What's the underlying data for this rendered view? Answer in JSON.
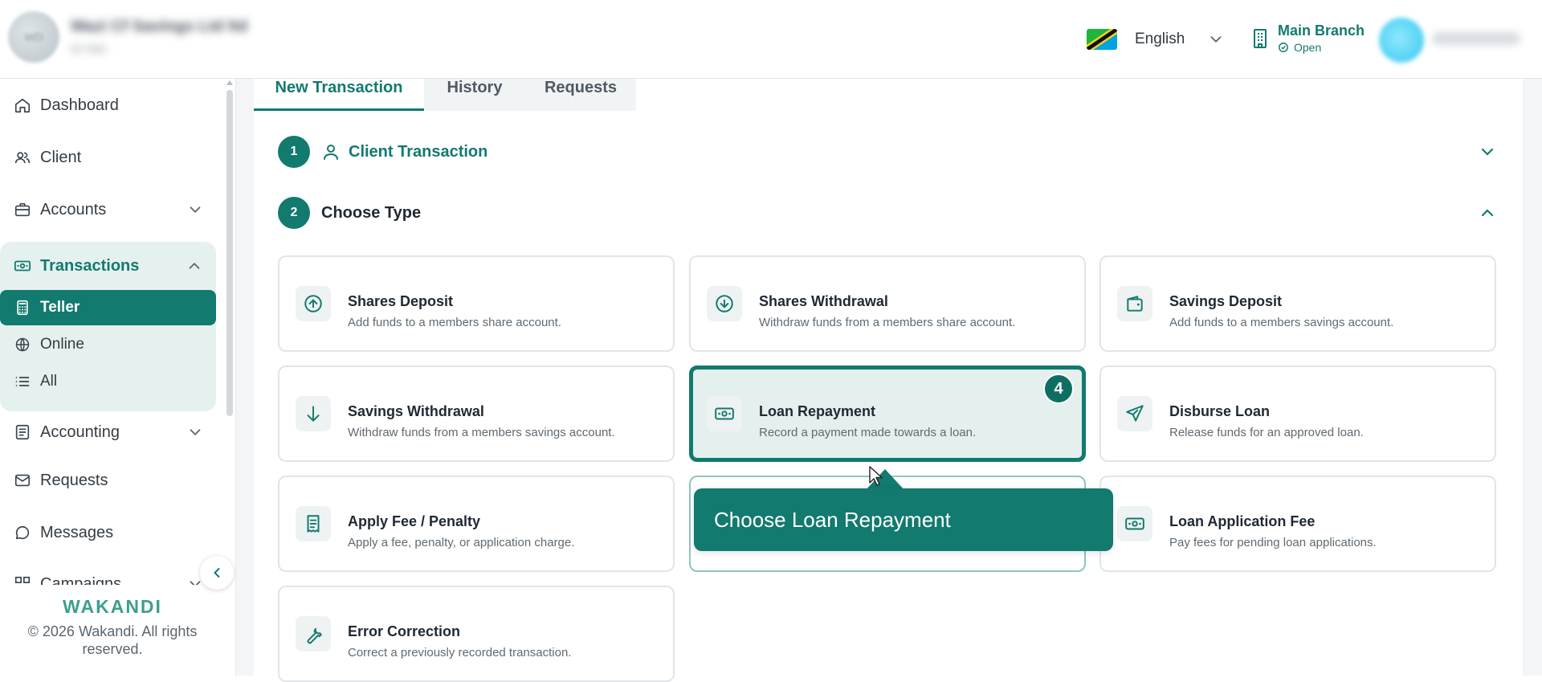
{
  "header": {
    "org_avatar_text": "WD",
    "org_name": "Wazi Cf Savings Ltd ltd",
    "org_sub": "ID 000",
    "language": "English",
    "branch_name": "Main Branch",
    "branch_status": "Open",
    "user_name": "Wakandi Admin"
  },
  "sidebar": {
    "items": [
      {
        "label": "Dashboard",
        "icon": "home-icon"
      },
      {
        "label": "Client",
        "icon": "users-icon"
      },
      {
        "label": "Accounts",
        "icon": "briefcase-icon"
      },
      {
        "label": "Transactions",
        "icon": "banknote-icon"
      },
      {
        "label": "Accounting",
        "icon": "ledger-icon"
      },
      {
        "label": "Requests",
        "icon": "mail-icon"
      },
      {
        "label": "Messages",
        "icon": "chat-icon"
      },
      {
        "label": "Campaigns",
        "icon": "grid-icon"
      }
    ],
    "sub_items": [
      {
        "label": "Teller",
        "icon": "calculator-icon"
      },
      {
        "label": "Online",
        "icon": "globe-icon"
      },
      {
        "label": "All",
        "icon": "list-icon"
      }
    ],
    "brand": "WAKANDI",
    "copyright": "© 2026 Wakandi. All rights reserved."
  },
  "tabs": [
    "New Transaction",
    "History",
    "Requests"
  ],
  "steps": [
    {
      "number": "1",
      "title": "Client Transaction"
    },
    {
      "number": "2",
      "title": "Choose Type"
    }
  ],
  "cards": [
    {
      "title": "Shares Deposit",
      "description": "Add funds to a members share account.",
      "icon": "arrow-up-circle-icon"
    },
    {
      "title": "Shares Withdrawal",
      "description": "Withdraw funds from a members share account.",
      "icon": "arrow-down-circle-icon"
    },
    {
      "title": "Savings Deposit",
      "description": "Add funds to a members savings account.",
      "icon": "wallet-icon"
    },
    {
      "title": "Savings Withdrawal",
      "description": "Withdraw funds from a members savings account.",
      "icon": "arrow-down-icon"
    },
    {
      "title": "Loan Repayment",
      "description": "Record a payment made towards a loan.",
      "icon": "banknote-icon"
    },
    {
      "title": "Disburse Loan",
      "description": "Release funds for an approved loan.",
      "icon": "send-icon"
    },
    {
      "title": "Apply Fee / Penalty",
      "description": "Apply a fee, penalty, or application charge.",
      "icon": "receipt-icon"
    },
    {
      "title": "",
      "description": "",
      "icon": ""
    },
    {
      "title": "Loan Application Fee",
      "description": "Pay fees for pending loan applications.",
      "icon": "banknote-icon"
    },
    {
      "title": "Error Correction",
      "description": "Correct a previously recorded transaction.",
      "icon": "wrench-icon"
    }
  ],
  "step_badge": "4",
  "tooltip": "Choose Loan Repayment",
  "colors": {
    "accent": "#127a6e",
    "accent_light": "#e5f1ef",
    "selected_card_bg": "#e3f0ee"
  }
}
